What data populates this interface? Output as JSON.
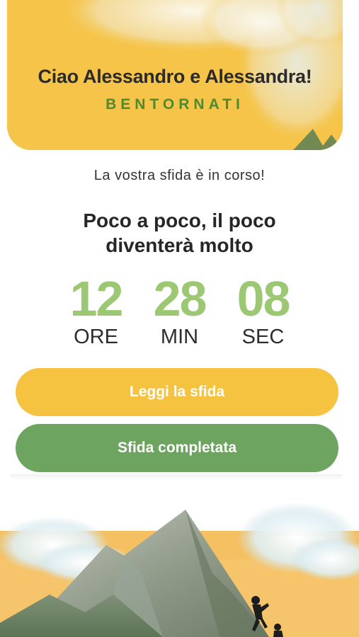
{
  "header": {
    "greeting": "Ciao Alessandro e Alessandra!",
    "subtitle": "BENTORNATI"
  },
  "challenge": {
    "status": "La vostra sfida è in corso!",
    "title": "Poco a poco, il poco diventerà molto"
  },
  "countdown": {
    "hours": {
      "value": "12",
      "label": "ORE"
    },
    "minutes": {
      "value": "28",
      "label": "MIN"
    },
    "seconds": {
      "value": "08",
      "label": "SEC"
    }
  },
  "actions": {
    "read_label": "Leggi la sfida",
    "complete_label": "Sfida completata"
  },
  "colors": {
    "yellow": "#f5c33f",
    "green_button": "#6da45f",
    "green_text": "#9cc874",
    "dark_green": "#4f8a2e"
  }
}
